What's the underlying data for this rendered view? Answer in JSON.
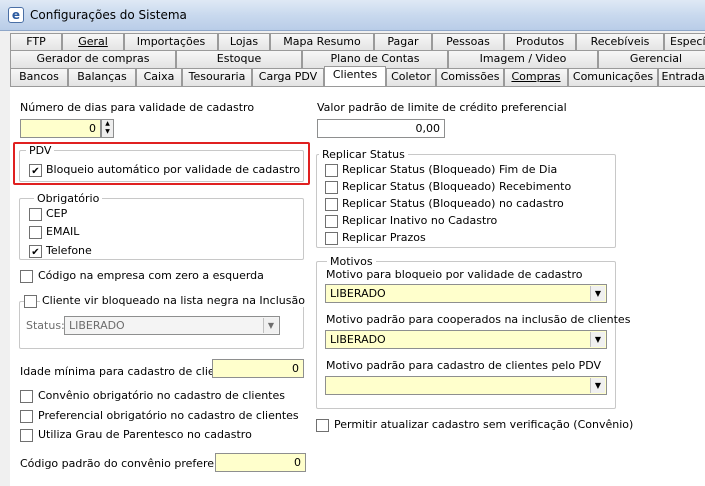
{
  "window": {
    "title": "Configurações do Sistema",
    "icon": "app-e-icon"
  },
  "tabs_row1": [
    "FTP",
    "Geral",
    "Importações",
    "Lojas",
    "Mapa Resumo",
    "Pagar",
    "Pessoas",
    "Produtos",
    "Recebíveis",
    "Especí"
  ],
  "tabs_row2": [
    "Gerador de compras",
    "Estoque",
    "Plano de Contas",
    "Imagem / Video",
    "Gerencial"
  ],
  "tabs_row3": [
    "Bancos",
    "Balanças",
    "Caixa",
    "Tesouraria",
    "Carga PDV",
    "Clientes",
    "Coletor",
    "Comissões",
    "Compras",
    "Comunicações",
    "Entradas"
  ],
  "active_tab": "Clientes",
  "left": {
    "dias_label": "Número de dias para validade de cadastro",
    "dias_value": "0",
    "pdv": {
      "legend": "PDV",
      "bloqueio_label": "Bloqueio automático por validade de cadastro",
      "bloqueio_checked": true
    },
    "obrigatorio": {
      "legend": "Obrigatório",
      "items": [
        {
          "label": "CEP",
          "checked": false
        },
        {
          "label": "EMAIL",
          "checked": false
        },
        {
          "label": "Telefone",
          "checked": true
        }
      ]
    },
    "codigo_zero_label": "Código na empresa com zero a esquerda",
    "negra": {
      "legend": "Cliente vir bloqueado na lista negra na Inclusão",
      "status_label": "Status:",
      "status_value": "LIBERADO"
    },
    "idade_label": "Idade mínima para cadastro de clientes:",
    "idade_value": "0",
    "checks": [
      "Convênio obrigatório no cadastro de clientes",
      "Preferencial obrigatório no cadastro de clientes",
      "Utiliza Grau de Parentesco no cadastro"
    ],
    "convenio_label": "Código padrão do convênio preferencial:",
    "convenio_value": "0"
  },
  "right": {
    "limite_label": "Valor padrão de limite de crédito preferencial",
    "limite_value": "0,00",
    "replicar": {
      "legend": "Replicar Status",
      "items": [
        "Replicar Status (Bloqueado) Fim de Dia",
        "Replicar Status (Bloqueado) Recebimento",
        "Replicar Status (Bloqueado) no cadastro",
        "Replicar Inativo no Cadastro",
        "Replicar Prazos"
      ]
    },
    "motivos": {
      "legend": "Motivos",
      "bloqueio_label": "Motivo para bloqueio por validade de cadastro",
      "bloqueio_value": "LIBERADO",
      "cooperados_label": "Motivo padrão para cooperados na inclusão de clientes",
      "cooperados_value": "LIBERADO",
      "pdv_label": "Motivo padrão para cadastro de clientes pelo PDV",
      "pdv_value": ""
    },
    "permitir_label": "Permitir atualizar cadastro sem verificação (Convênio)"
  }
}
